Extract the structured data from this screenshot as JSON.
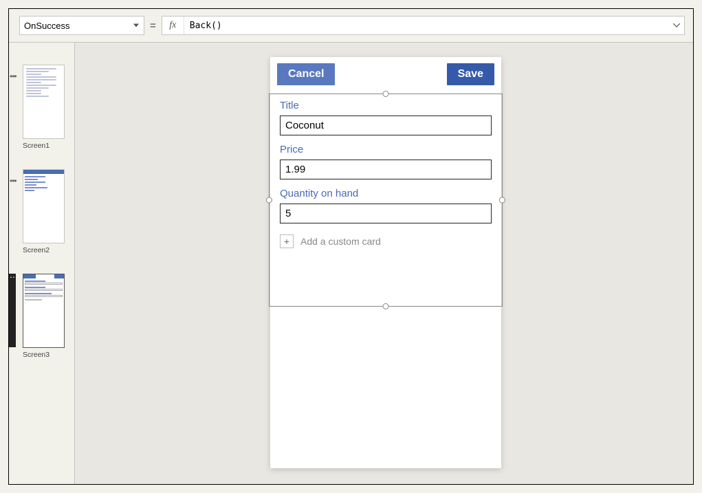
{
  "formula_bar": {
    "property": "OnSuccess",
    "equals": "=",
    "fx_label": "fx",
    "value": "Back()"
  },
  "thumbnails": {
    "screen1": "Screen1",
    "screen2": "Screen2",
    "screen3": "Screen3"
  },
  "form": {
    "cancel_label": "Cancel",
    "save_label": "Save",
    "fields": {
      "title_label": "Title",
      "title_value": "Coconut",
      "price_label": "Price",
      "price_value": "1.99",
      "qty_label": "Quantity on hand",
      "qty_value": "5"
    },
    "add_card_label": "Add a custom card",
    "plus_glyph": "+"
  }
}
